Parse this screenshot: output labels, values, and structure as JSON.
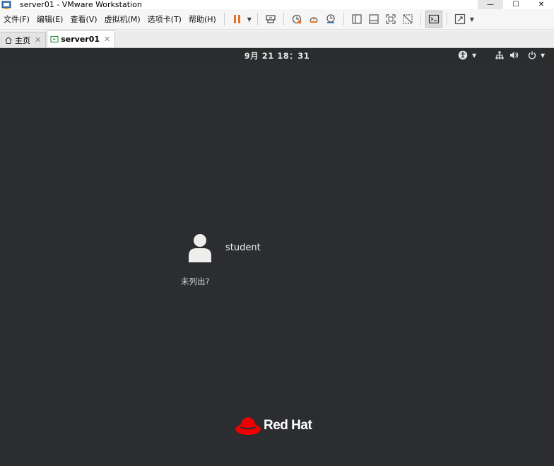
{
  "window": {
    "title": "server01 - VMware Workstation",
    "controls": {
      "minimize": "—",
      "maximize": "☐",
      "close": "✕"
    }
  },
  "menu": [
    {
      "label": "文件(F)"
    },
    {
      "label": "编辑(E)"
    },
    {
      "label": "查看(V)"
    },
    {
      "label": "虚拟机(M)"
    },
    {
      "label": "选项卡(T)"
    },
    {
      "label": "帮助(H)"
    }
  ],
  "tabs": [
    {
      "label": "主页",
      "icon": "home-icon",
      "active": false
    },
    {
      "label": "server01",
      "icon": "vm-icon",
      "active": true
    }
  ],
  "guest": {
    "clock": "9月 21  18：31",
    "user": {
      "name": "student",
      "icon": "user-avatar-icon"
    },
    "not_listed": "未列出?",
    "brand": "Red Hat"
  },
  "colors": {
    "guest_background": "#2b2d30",
    "pause_orange": "#e8712a",
    "redhat_red": "#ee0000"
  }
}
